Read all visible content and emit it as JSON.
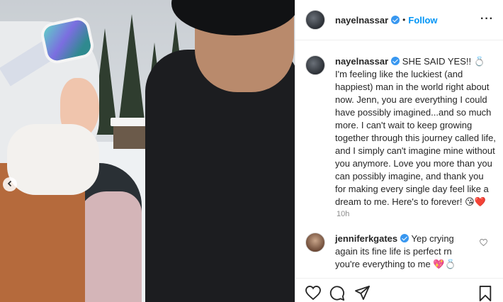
{
  "post": {
    "photo_alt": "",
    "username": "nayelnassar",
    "separator": "•",
    "follow_label": "Follow",
    "more_label": "···",
    "caption_user": "nayelnassar",
    "caption_text": "SHE SAID YES!! 💍 I'm feeling like the luckiest (and happiest) man in the world right about now. Jenn, you are everything I could have possibly imagined...and so much more. I can't wait to keep growing together through this journey called life, and I simply can't imagine mine without you anymore. Love you more than you can possibly imagine, and thank you for making every single day feel like a dream to me. Here's to forever! 😘❤️",
    "time_ago": "10h"
  },
  "comment": {
    "username": "jenniferkgates",
    "text": "Yep crying again its fine life is perfect rn you're everything to me 💖💍"
  },
  "icons": {
    "like": "heart-outline-icon",
    "comment": "speech-bubble-icon",
    "share": "paper-plane-icon",
    "save": "bookmark-icon",
    "prev": "chevron-left-icon"
  },
  "colors": {
    "accent": "#0095f6",
    "verified": "#3897f0",
    "muted": "#8e8e8e",
    "border": "#efefef"
  }
}
